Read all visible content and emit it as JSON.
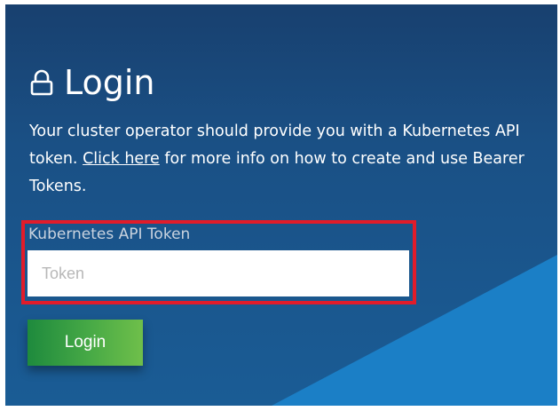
{
  "login": {
    "title": "Login",
    "lock_icon": "lock-icon",
    "description_prefix": "Your cluster operator should provide you with a Kubernetes API token. ",
    "link_text": "Click here",
    "description_suffix": " for more info on how to create and use Bearer Tokens.",
    "token_label": "Kubernetes API Token",
    "token_placeholder": "Token",
    "token_value": "",
    "button_label": "Login"
  },
  "colors": {
    "background_top": "#18406f",
    "background_bottom": "#1a5c95",
    "accent_stripe": "#1b7fc6",
    "button_start": "#1e8a3d",
    "button_end": "#6fbf4a",
    "highlight": "#e11c2a"
  }
}
